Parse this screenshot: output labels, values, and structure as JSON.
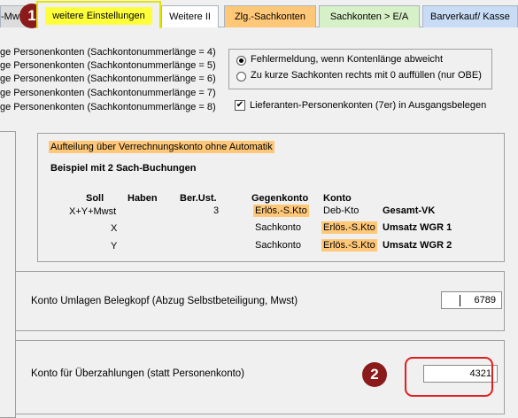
{
  "tabs": {
    "mwst": "-Mwst",
    "active": "weitere Einstellungen",
    "weitere2": "Weitere II",
    "zlg": "Zlg.-Sachkonten",
    "sachkonten_ea": "Sachkonten > E/A",
    "barverkauf": "Barverkauf/ Kasse"
  },
  "account_lengths": [
    "ge Personenkonten (Sachkontonummerlänge = 4)",
    "ge Personenkonten (Sachkontonummerlänge = 5)",
    "ge Personenkonten (Sachkontonummerlänge = 6)",
    "ge Personenkonten (Sachkontonummerlänge = 7)",
    "ge Personenkonten (Sachkontonummerlänge = 8)"
  ],
  "options": {
    "error_label": "Fehlermeldung, wenn Kontenlänge abweicht",
    "fill_label": "Zu kurze Sachkonten rechts mit 0 auffüllen (nur OBE)",
    "supplier_label": "Lieferanten-Personenkonten (7er) in Ausgangsbelegen",
    "supplier_checked": "✔"
  },
  "example": {
    "heading": "Aufteilung über Verrechnungskonto ohne Automatik",
    "subheading": "Beispiel mit 2 Sach-Buchungen",
    "headers": {
      "soll": "Soll",
      "haben": "Haben",
      "berust": "Ber.Ust.",
      "gegenkonto": "Gegenkonto",
      "konto": "Konto"
    },
    "rows": [
      {
        "soll": "X+Y+Mwst",
        "berust": "3",
        "gegenkonto": "Erlös.-S.Kto",
        "konto": "Deb-Kto",
        "desc": "Gesamt-VK"
      },
      {
        "soll": "X",
        "berust": "",
        "gegenkonto": "Sachkonto",
        "konto": "Erlös.-S.Kto",
        "desc": "Umsatz WGR 1"
      },
      {
        "soll": "Y",
        "berust": "",
        "gegenkonto": "Sachkonto",
        "konto": "Erlös.-S.Kto",
        "desc": "Umsatz WGR 2"
      }
    ]
  },
  "umlagen": {
    "label": "Konto Umlagen Belegkopf (Abzug Selbstbeteiligung, Mwst)",
    "value": "6789"
  },
  "ueberzahlung": {
    "label": "Konto für Überzahlungen (statt Personenkonto)",
    "value": "4321"
  },
  "badges": {
    "one": "1",
    "two": "2"
  },
  "colors": {
    "tab_yellow": "#ffff3c",
    "highlight_orange": "#ffc878",
    "badge_red": "#8b1a1a",
    "callout_red": "#e02020"
  }
}
